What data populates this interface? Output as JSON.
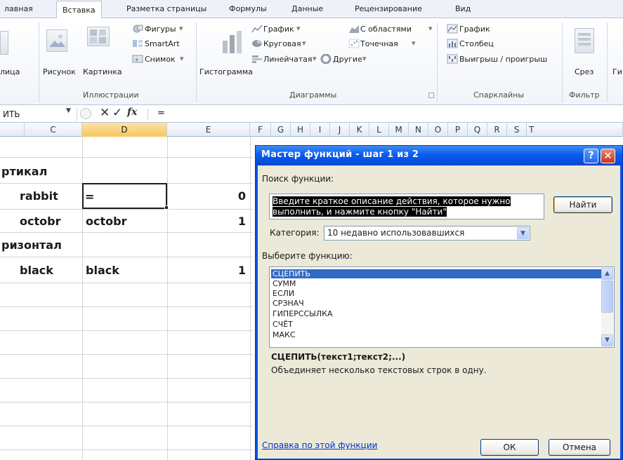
{
  "tabs": [
    "лавная",
    "Вставка",
    "Разметка страницы",
    "Формулы",
    "Данные",
    "Рецензирование",
    "Вид"
  ],
  "ribbon": {
    "table_partial": "лица",
    "picture": "Рисунок",
    "clipart": "Картинка",
    "shapes": "Фигуры",
    "smartart": "SmartArt",
    "screenshot": "Снимок",
    "illustrations_group": "Иллюстрации",
    "histogram": "Гистограмма",
    "chart_graph": "График",
    "chart_pie": "Круговая",
    "chart_bar": "Линейчатая",
    "chart_area": "С областями",
    "chart_scatter": "Точечная",
    "chart_other": "Другие",
    "charts_group": "Диаграммы",
    "spark_line": "График",
    "spark_column": "Столбец",
    "spark_winloss": "Выигрыш / проигрыш",
    "sparklines_group": "Спарклайны",
    "slicer": "Срез",
    "filter_group": "Фильтр",
    "hyperlink_partial": "Ги"
  },
  "formula_bar": {
    "name_box": "ИТЬ",
    "value": "="
  },
  "columns": [
    "C",
    "D",
    "E",
    "F",
    "G",
    "H",
    "I",
    "J",
    "K",
    "L",
    "M",
    "N",
    "O",
    "P",
    "Q",
    "R",
    "S",
    "T"
  ],
  "cells": {
    "r1_c": "ртикал",
    "r2_c": "rabbit",
    "r2_d": "=",
    "r2_e": "0",
    "r3_c": "octobr",
    "r3_d": "octobr",
    "r3_e": "1",
    "r4_c": "ризонтал",
    "r5_c": "black",
    "r5_d": "black",
    "r5_e": "1"
  },
  "dialog": {
    "title": "Мастер функций - шаг 1 из 2",
    "search_label": "Поиск функции:",
    "search_text_line1": "Введите краткое описание действия, которое нужно",
    "search_text_line2": "выполнить, и нажмите кнопку \"Найти\"",
    "find_button": "Найти",
    "category_label": "Категория:",
    "category_value": "10 недавно использовавшихся",
    "select_label": "Выберите функцию:",
    "functions": [
      "СЦЕПИТЬ",
      "СУММ",
      "ЕСЛИ",
      "СРЗНАЧ",
      "ГИПЕРССЫЛКА",
      "СЧЁТ",
      "МАКС"
    ],
    "signature": "СЦЕПИТЬ(текст1;текст2;...)",
    "description": "Объединяет несколько текстовых строк в одну.",
    "help_link": "Справка по этой функции",
    "ok_button": "ОК",
    "cancel_button": "Отмена"
  }
}
